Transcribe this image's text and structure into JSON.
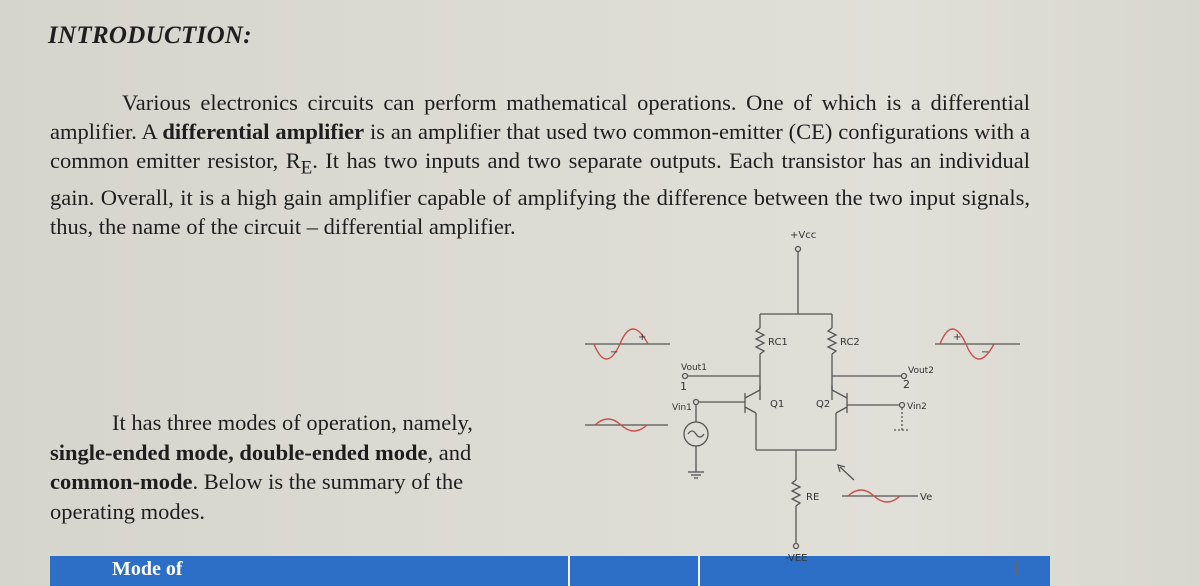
{
  "document": {
    "heading": "INTRODUCTION:",
    "paragraph1": {
      "part1": "Various electronics circuits can perform mathematical operations. One of which is a differential amplifier. A ",
      "bold1": "differential amplifier",
      "part2": " is an amplifier that used two common-emitter (CE) configurations with a common emitter resistor, R",
      "sub": "E",
      "part3": ". It has two inputs and two separate outputs. Each transistor has an individual gain. Overall, it is a high gain amplifier capable of amplifying the difference between the two input signals, thus, the name of the circuit – differential amplifier."
    },
    "paragraph2": {
      "part1": "It has three modes of operation, namely, ",
      "bold1": "single-ended mode, double-ended mode",
      "part2": ", and ",
      "bold2": "common-mode",
      "part3": ". Below is the summary of the operating modes."
    },
    "table": {
      "header_col1": "Mode of",
      "header_color": "#2d6fc6"
    }
  },
  "circuit": {
    "vcc": "+Vcc",
    "rc1": "RC1",
    "rc2": "RC2",
    "vout1": "Vout1",
    "vout2": "Vout2",
    "node1": "1",
    "node2": "2",
    "vin1": "Vin1",
    "vin2": "Vin2",
    "q1": "Q1",
    "q2": "Q2",
    "re": "RE",
    "vee": "-VEE",
    "ve": "Ve",
    "plus": "+",
    "minus": "−",
    "waveform_color": "#c8504a"
  }
}
